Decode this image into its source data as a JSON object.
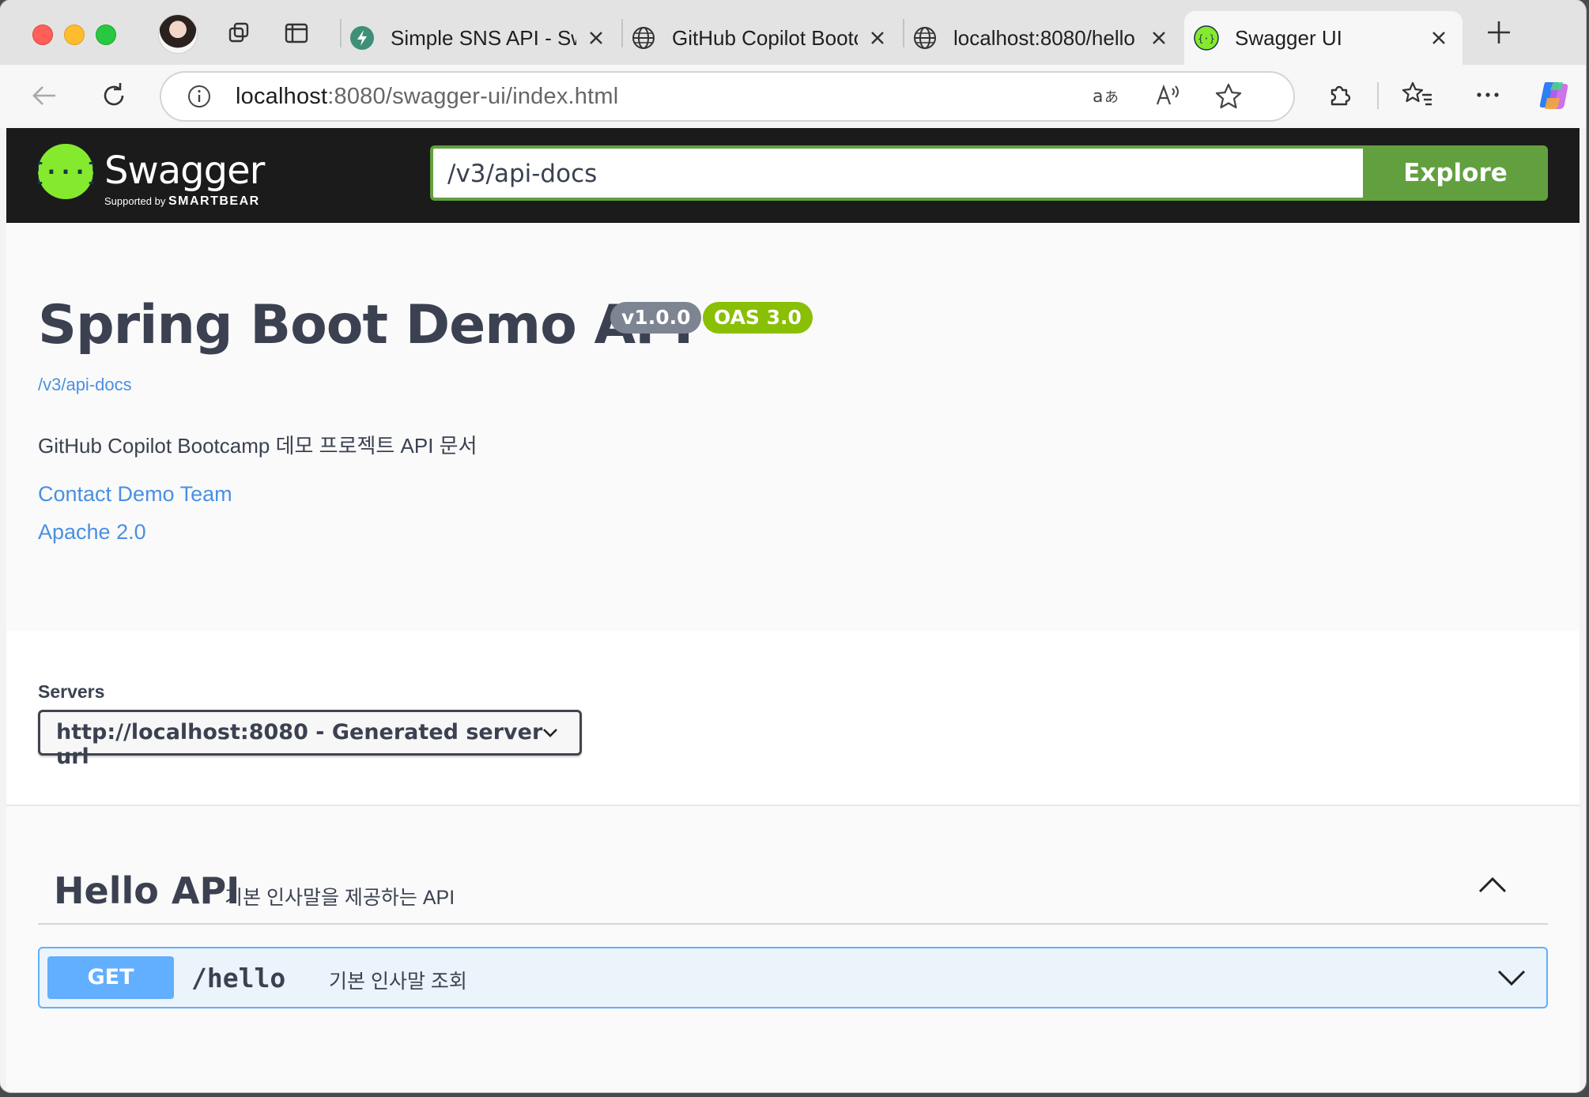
{
  "browser": {
    "tabs": [
      {
        "title": "Simple SNS API - Sw"
      },
      {
        "title": "GitHub Copilot Bootc"
      },
      {
        "title": "localhost:8080/hello"
      },
      {
        "title": "Swagger UI"
      }
    ],
    "address": {
      "host": "localhost",
      "rest": ":8080/swagger-ui/index.html"
    }
  },
  "swagger": {
    "brand": "Swagger",
    "supported_by": "Supported by",
    "smartbear": "SMARTBEAR",
    "url_input": "/v3/api-docs",
    "explore_label": "Explore"
  },
  "info": {
    "title": "Spring Boot Demo API",
    "version_badge": "v1.0.0",
    "oas_badge": "OAS 3.0",
    "spec_link": "/v3/api-docs",
    "description": "GitHub Copilot Bootcamp 데모 프로젝트 API 문서",
    "contact_link": "Contact Demo Team",
    "license_link": "Apache 2.0"
  },
  "servers": {
    "label": "Servers",
    "selected": "http://localhost:8080 - Generated server url"
  },
  "tag": {
    "name": "Hello API",
    "description": "기본 인사말을 제공하는 API"
  },
  "operation": {
    "method": "GET",
    "path": "/hello",
    "summary": "기본 인사말 조회"
  },
  "colors": {
    "swagger_green": "#85ea2d",
    "explore_green": "#62a03f",
    "get_blue": "#61affe",
    "version_badge": "#7d8492",
    "oas_badge": "#89bf04",
    "link_blue": "#4990e2"
  }
}
